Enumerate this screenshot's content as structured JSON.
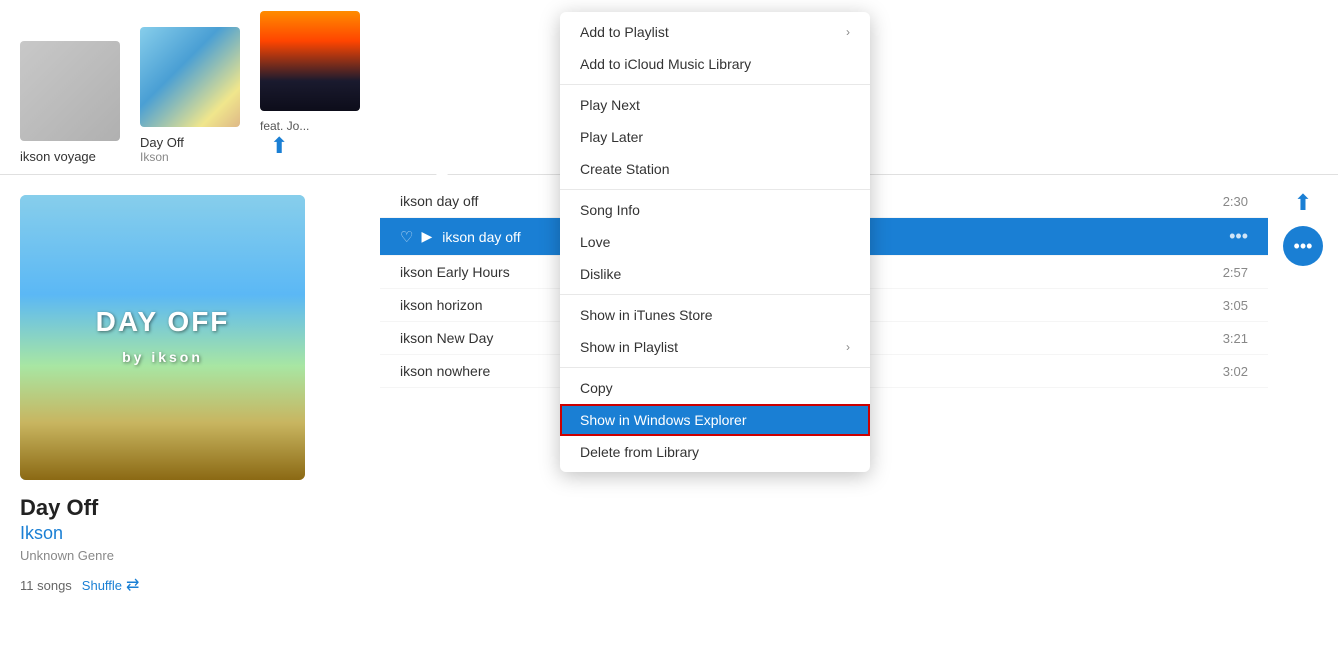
{
  "topAlbums": [
    {
      "id": "voyage",
      "title": "ikson voyage",
      "artist": "",
      "thumbType": "voyage"
    },
    {
      "id": "dayoff-top",
      "title": "Day Off",
      "artist": "Ikson",
      "thumbType": "dayoff"
    },
    {
      "id": "cityscape",
      "title": "feat. Jo...",
      "artist": "",
      "thumbType": "cityscape",
      "hasDownload": true
    }
  ],
  "albumDetail": {
    "coverText": "DAY OFF\nby ikson",
    "title": "Day Off",
    "artist": "Ikson",
    "genre": "Unknown Genre",
    "songsCount": "11 songs",
    "shuffleLabel": "Shuffle"
  },
  "songs": [
    {
      "id": 1,
      "title": "ikson day off",
      "duration": "2:30",
      "active": false
    },
    {
      "id": 2,
      "title": "ikson day off",
      "duration": "",
      "active": true
    },
    {
      "id": 3,
      "title": "ikson Early Hours",
      "duration": "2:57",
      "active": false
    },
    {
      "id": 4,
      "title": "ikson horizon",
      "duration": "3:05",
      "active": false
    },
    {
      "id": 5,
      "title": "ikson New Day",
      "duration": "3:21",
      "active": false
    },
    {
      "id": 6,
      "title": "ikson nowhere",
      "duration": "3:02",
      "active": false
    }
  ],
  "contextMenu": {
    "sections": [
      {
        "items": [
          {
            "label": "Add to Playlist",
            "hasArrow": true
          },
          {
            "label": "Add to iCloud Music Library",
            "hasArrow": false
          }
        ]
      },
      {
        "items": [
          {
            "label": "Play Next",
            "hasArrow": false
          },
          {
            "label": "Play Later",
            "hasArrow": false
          },
          {
            "label": "Create Station",
            "hasArrow": false
          }
        ]
      },
      {
        "items": [
          {
            "label": "Song Info",
            "hasArrow": false
          },
          {
            "label": "Love",
            "hasArrow": false
          },
          {
            "label": "Dislike",
            "hasArrow": false
          }
        ]
      },
      {
        "items": [
          {
            "label": "Show in iTunes Store",
            "hasArrow": false
          },
          {
            "label": "Show in Playlist",
            "hasArrow": true
          }
        ]
      },
      {
        "items": [
          {
            "label": "Copy",
            "hasArrow": false
          },
          {
            "label": "Show in Windows Explorer",
            "hasArrow": false,
            "highlighted": true
          },
          {
            "label": "Delete from Library",
            "hasArrow": false
          }
        ]
      }
    ]
  }
}
